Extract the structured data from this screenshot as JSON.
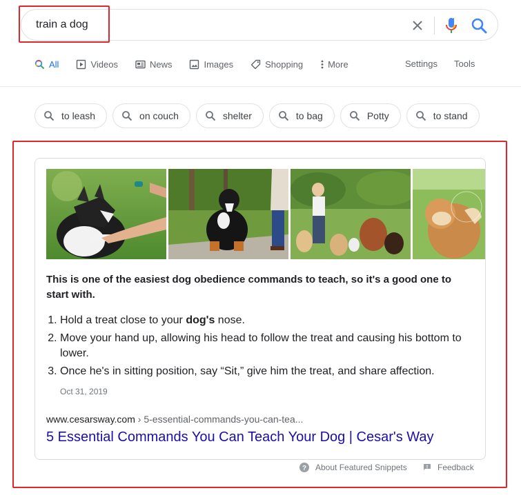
{
  "search": {
    "query": "train a dog"
  },
  "tabs": [
    {
      "label": "All",
      "icon": "search-icon",
      "active": true
    },
    {
      "label": "Videos",
      "icon": "video-icon"
    },
    {
      "label": "News",
      "icon": "news-icon"
    },
    {
      "label": "Images",
      "icon": "image-icon"
    },
    {
      "label": "Shopping",
      "icon": "tag-icon"
    },
    {
      "label": "More",
      "icon": "more-vert-icon"
    }
  ],
  "tools": {
    "settings": "Settings",
    "tools": "Tools"
  },
  "chips": [
    {
      "label": "to leash"
    },
    {
      "label": "on couch"
    },
    {
      "label": "shelter"
    },
    {
      "label": "to bag"
    },
    {
      "label": "Potty"
    },
    {
      "label": "to stand"
    }
  ],
  "snippet": {
    "lead": "This is one of the easiest dog obedience commands to teach, so it's a good one to start with.",
    "steps": [
      {
        "before": "Hold a treat close to your ",
        "bold": "dog's",
        "after": " nose."
      },
      {
        "before": "Move your hand up, allowing his head to follow the treat and causing his bottom to lower.",
        "bold": "",
        "after": ""
      },
      {
        "before": "Once he's in sitting position, say “Sit,” give him the treat, and share affection.",
        "bold": "",
        "after": ""
      }
    ],
    "date": "Oct 31, 2019",
    "cite_domain": "www.cesarsway.com",
    "cite_path": " › 5-essential-commands-you-can-tea...",
    "title": "5 Essential Commands You Can Teach Your Dog | Cesar's Way"
  },
  "footer": {
    "about": "About Featured Snippets",
    "feedback": "Feedback"
  },
  "colors": {
    "link": "#1a0dab",
    "accent": "#1a73e8",
    "highlight_box": "#e0262b"
  }
}
